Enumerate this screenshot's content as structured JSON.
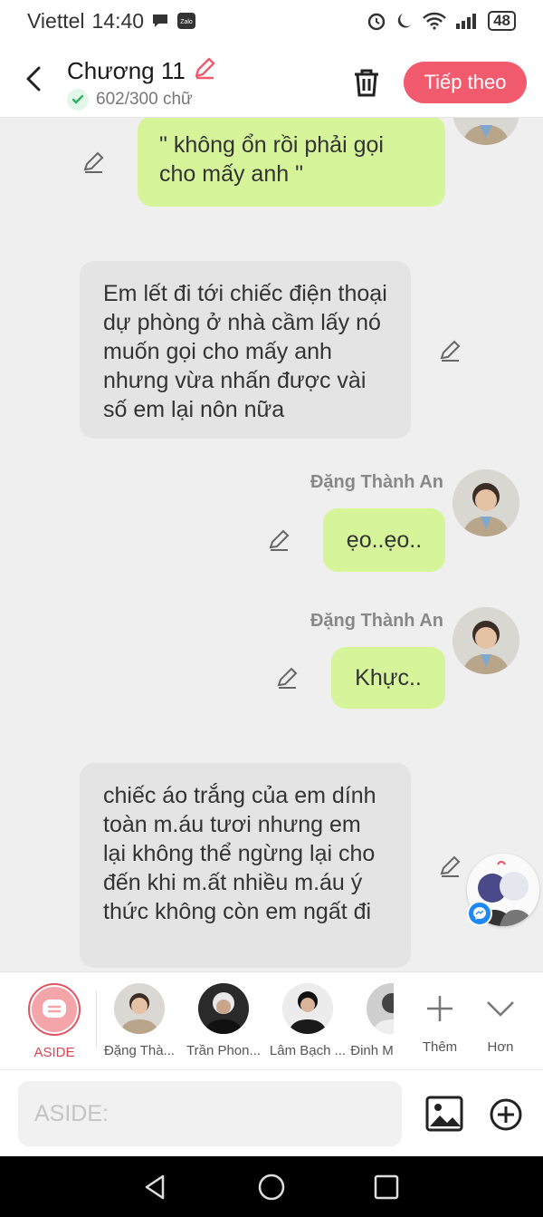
{
  "status_bar": {
    "carrier": "Viettel",
    "time": "14:40",
    "battery": "48",
    "zalo_label": "Zalo"
  },
  "header": {
    "title": "Chương 11",
    "word_count": "602/300 chữ",
    "next_label": "Tiếp theo"
  },
  "messages": [
    {
      "text": "\" không ổn rồi phải gọi cho mấy anh \""
    },
    {
      "text": "Em lết đi tới chiếc điện thoại dự phòng ở nhà cầm lấy nó muốn gọi cho mấy anh nhưng vừa nhấn được vài số em lại nôn nữa"
    },
    {
      "speaker": "Đặng Thành An",
      "text": "ẹo..ẹo.."
    },
    {
      "speaker": "Đặng Thành An",
      "text": "Khực.."
    },
    {
      "text": "chiếc áo trắng của em dính toàn m.áu tươi nhưng em lại không thể ngừng lại cho đến khi m.ất nhiều m.áu ý thức không còn em ngất đi"
    }
  ],
  "characters": [
    {
      "name": "ASIDE"
    },
    {
      "name": "Đặng Thà..."
    },
    {
      "name": "Trần Phon..."
    },
    {
      "name": "Lâm Bạch ..."
    },
    {
      "name": "Đinh M"
    }
  ],
  "more_actions": {
    "add_label": "Thêm",
    "more_label": "Hơn"
  },
  "input": {
    "placeholder": "ASIDE:"
  },
  "colors": {
    "accent": "#f25a6e",
    "bubble_green": "#d6f59a",
    "bubble_gray": "#e4e4e4"
  }
}
